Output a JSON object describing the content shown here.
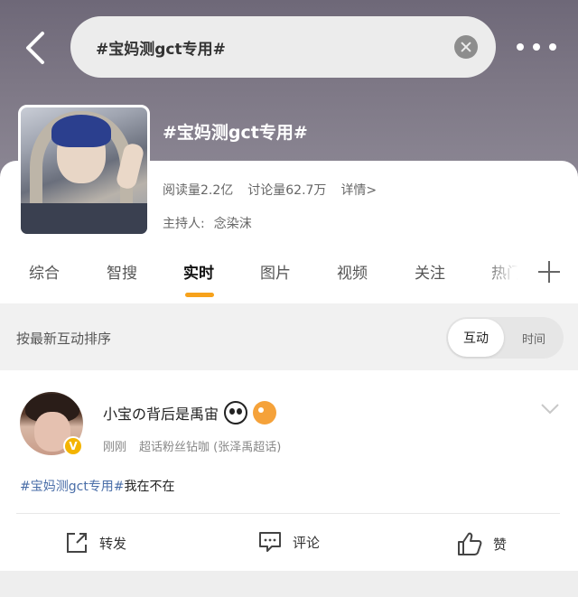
{
  "header": {
    "search_text": "#宝妈测gct专用#"
  },
  "topic": {
    "title": "#宝妈测gct专用#",
    "reads": "阅读量2.2亿",
    "discussions": "讨论量62.7万",
    "details": "详情>",
    "host_label": "主持人:",
    "host_name": "念染沫"
  },
  "tabs": [
    {
      "label": "综合"
    },
    {
      "label": "智搜"
    },
    {
      "label": "实时"
    },
    {
      "label": "图片"
    },
    {
      "label": "视频"
    },
    {
      "label": "关注"
    },
    {
      "label": "热门"
    }
  ],
  "active_tab": "实时",
  "sort": {
    "label": "按最新互动排序",
    "option_active": "互动",
    "option_inactive": "时间"
  },
  "post": {
    "author": "小宝の背后是禹宙",
    "verified_badge": "V",
    "time": "刚刚",
    "source": "超话粉丝钻咖 (张泽禹超话)",
    "tag": "#宝妈测gct专用#",
    "text": "我在不在",
    "actions": {
      "repost": "转发",
      "comment": "评论",
      "like": "赞"
    }
  },
  "colors": {
    "accent": "#f7a21b",
    "link": "#4a6ea8",
    "verified": "#f4b400"
  }
}
